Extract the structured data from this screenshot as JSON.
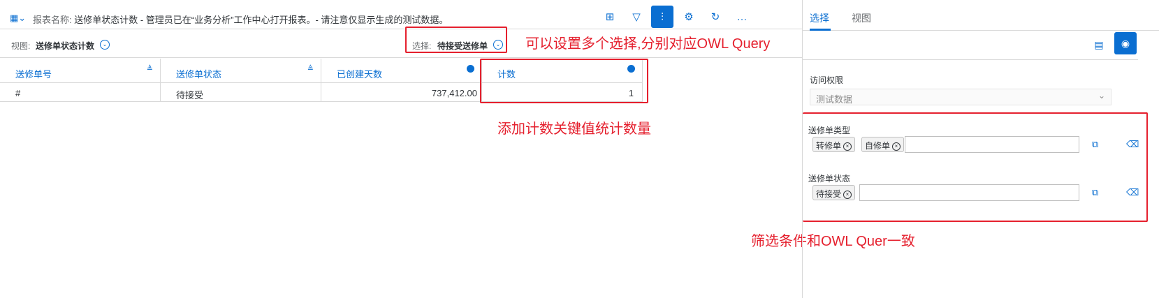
{
  "toolbar": {
    "report_label": "报表名称:",
    "report_name": "送修单状态计数 - 管理员已在“业务分析”工作中心打开报表。- 请注意仅显示生成的测试数据。"
  },
  "viewbar": {
    "view_label": "视图:",
    "view_value": "送修单状态计数",
    "selection_label": "选择:",
    "selection_value": "待接受送修单"
  },
  "table": {
    "columns": [
      "送修单号",
      "送修单状态",
      "已创建天数",
      "计数"
    ],
    "rows": [
      [
        "#",
        "待接受",
        "737,412.00",
        "1"
      ]
    ]
  },
  "annotations": {
    "selection_note": "可以设置多个选择,分别对应OWL Query",
    "count_note": "添加计数关键值统计数量",
    "filter_note": "筛选条件和OWL Quer一致"
  },
  "panel": {
    "tabs": [
      "选择",
      "视图"
    ],
    "access_label": "访问权限",
    "access_value": "测试数据",
    "type_label": "送修单类型",
    "type_tokens": [
      "转修单",
      "自修单"
    ],
    "status_label": "送修单状态",
    "status_tokens": [
      "待接受"
    ]
  },
  "colors": {
    "accent": "#0a6ed1",
    "annotation": "#e5202e"
  }
}
